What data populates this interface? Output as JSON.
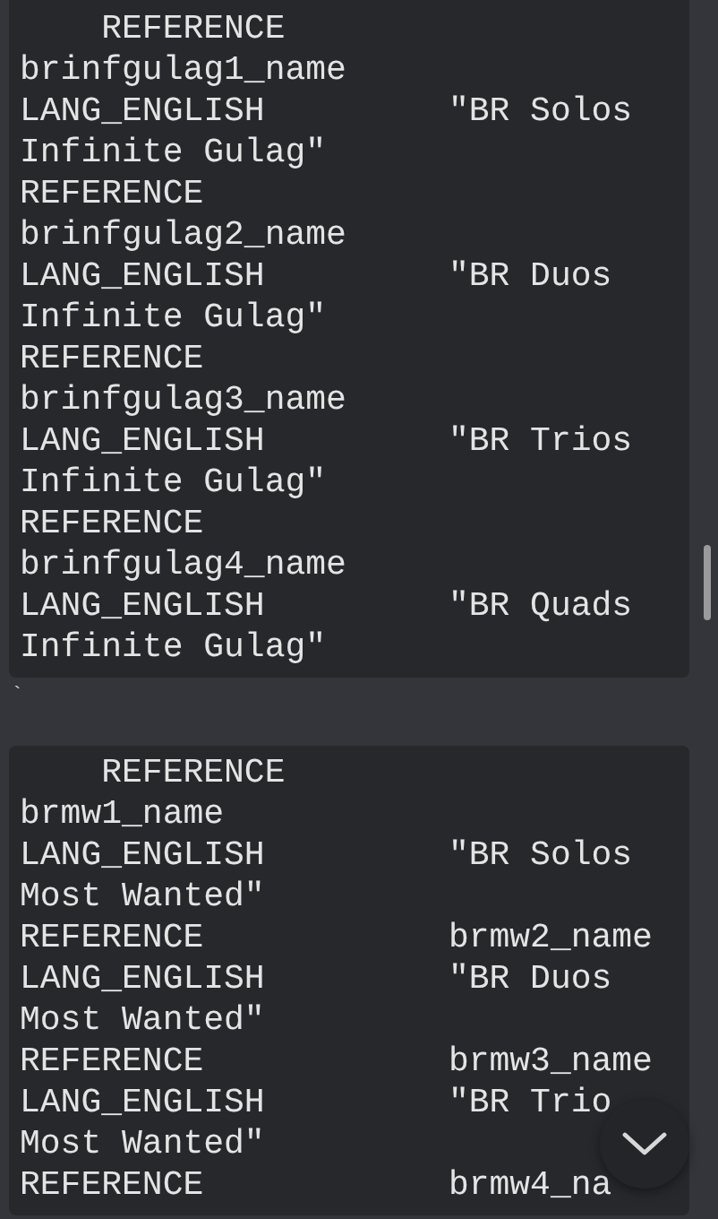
{
  "blocks": [
    {
      "lines": [
        "    REFERENCE",
        "brinfgulag1_name",
        "LANG_ENGLISH         \"BR Solos",
        "Infinite Gulag\"",
        "REFERENCE",
        "brinfgulag2_name",
        "LANG_ENGLISH         \"BR Duos",
        "Infinite Gulag\"",
        "REFERENCE",
        "brinfgulag3_name",
        "LANG_ENGLISH         \"BR Trios",
        "Infinite Gulag\"",
        "REFERENCE",
        "brinfgulag4_name",
        "LANG_ENGLISH         \"BR Quads",
        "Infinite Gulag\""
      ]
    },
    {
      "lines": [
        "    REFERENCE",
        "brmw1_name",
        "LANG_ENGLISH         \"BR Solos",
        "Most Wanted\"",
        "REFERENCE            brmw2_name",
        "LANG_ENGLISH         \"BR Duos",
        "Most Wanted\"",
        "REFERENCE            brmw3_name",
        "LANG_ENGLISH         \"BR Trio",
        "Most Wanted\"",
        "REFERENCE            brmw4_na"
      ]
    }
  ],
  "separator": "`"
}
